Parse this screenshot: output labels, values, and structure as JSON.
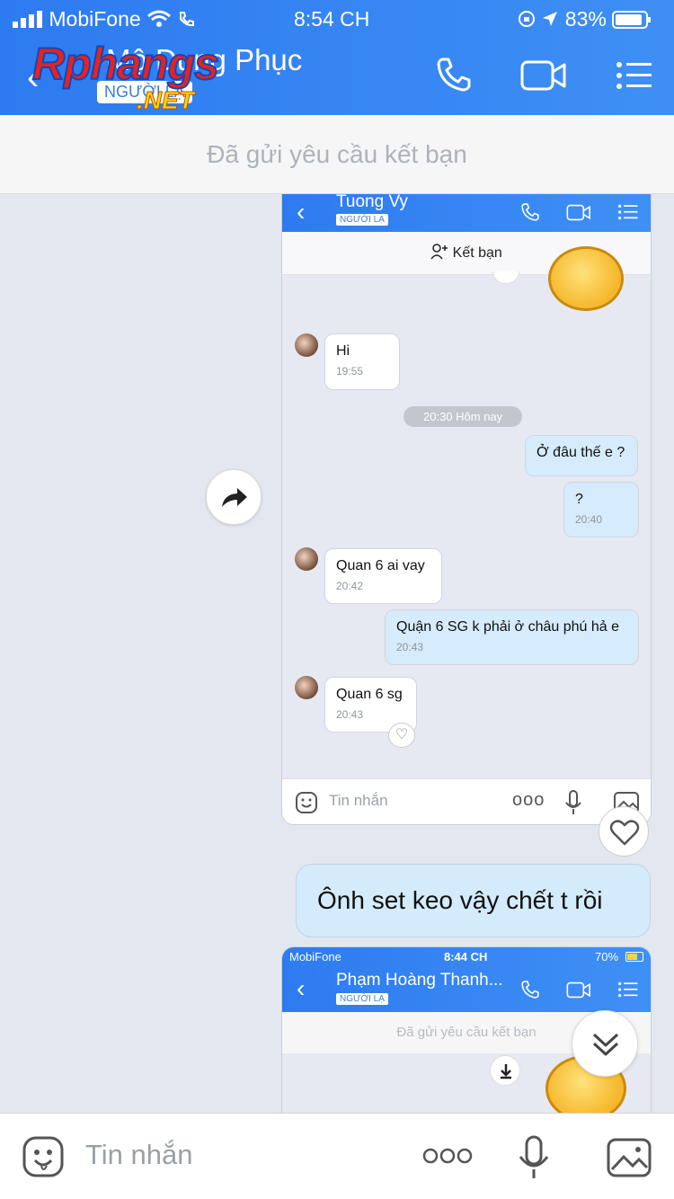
{
  "status_bar": {
    "carrier": "MobiFone",
    "time": "8:54 CH",
    "battery": "83%"
  },
  "header": {
    "contact_name": "Mộ Dung Phục",
    "tag": "NGƯỜI LẠ",
    "watermark": "Rphangs",
    "watermark_sub": ".NET"
  },
  "friend_request_banner": "Đã gửi yêu cầu kết bạn",
  "shared_screenshot_1": {
    "contact_name": "Tuong Vy",
    "tag": "NGƯỜI LẠ",
    "add_friend_label": "Kết bạn",
    "date_separator": "20:30 Hôm nay",
    "input_placeholder": "Tin nhắn",
    "messages": [
      {
        "dir": "in",
        "text": "Hi",
        "time": "19:55"
      },
      {
        "dir": "out",
        "text": "Ở đâu thế e ?"
      },
      {
        "dir": "out",
        "text": "?",
        "time": "20:40"
      },
      {
        "dir": "in",
        "text": "Quan 6 ai vay",
        "time": "20:42"
      },
      {
        "dir": "out",
        "text": "Quận 6 SG k phải ở châu phú hả e",
        "time": "20:43"
      },
      {
        "dir": "in",
        "text": "Quan 6 sg",
        "time": "20:43"
      }
    ]
  },
  "main_message": "Ônh set keo vậy chết t rồi",
  "shared_screenshot_2": {
    "carrier": "MobiFone",
    "time": "8:44 CH",
    "battery": "70%",
    "contact_name": "Phạm Hoàng Thanh...",
    "tag": "NGƯỜI LẠ",
    "friend_request_banner": "Đã gửi yêu cầu kết bạn"
  },
  "input_bar": {
    "placeholder": "Tin nhắn"
  },
  "colors": {
    "header_blue": "#2d7bf0",
    "outgoing_bubble": "#d6ebfb",
    "chat_bg": "#e3e8f0"
  }
}
